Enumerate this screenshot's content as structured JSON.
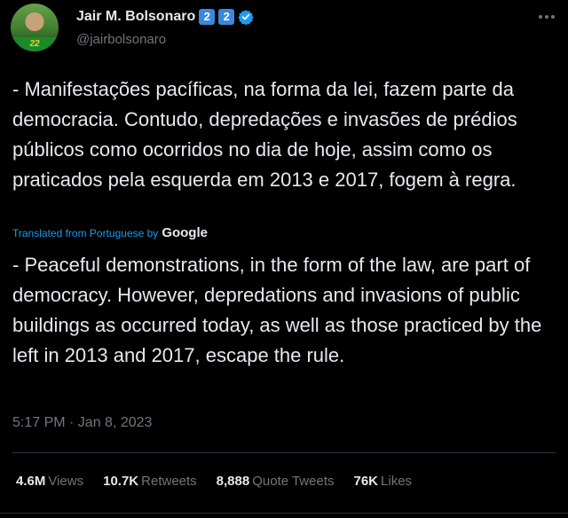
{
  "author": {
    "name": "Jair M. Bolsonaro",
    "badges": [
      "2",
      "2"
    ],
    "handle": "@jairbolsonaro",
    "avatar_banner": "22"
  },
  "tweet": {
    "text": "- Manifestações pacíficas, na forma da lei, fazem parte da democracia. Contudo, depredações e invasões de prédios públicos como ocorridos no dia de hoje, assim como os praticados pela esquerda em 2013 e 2017, fogem à regra.",
    "translated_label": "Translated from Portuguese by",
    "translator": "Google",
    "translation": "- Peaceful demonstrations, in the form of the law, are part of democracy. However, depredations and invasions of public buildings as occurred today, as well as those practiced by the left in 2013 and 2017, escape the rule.",
    "timestamp": "5:17 PM · Jan 8, 2023"
  },
  "stats": [
    {
      "value": "4.6M",
      "label": "Views"
    },
    {
      "value": "10.7K",
      "label": "Retweets"
    },
    {
      "value": "8,888",
      "label": "Quote Tweets"
    },
    {
      "value": "76K",
      "label": "Likes"
    }
  ],
  "colors": {
    "background": "#000000",
    "text": "#e7e9ea",
    "muted": "#71767b",
    "accent": "#1d9bf0",
    "badge": "#3b87d9"
  },
  "icons": [
    "verified-badge-icon",
    "more-options-icon"
  ]
}
